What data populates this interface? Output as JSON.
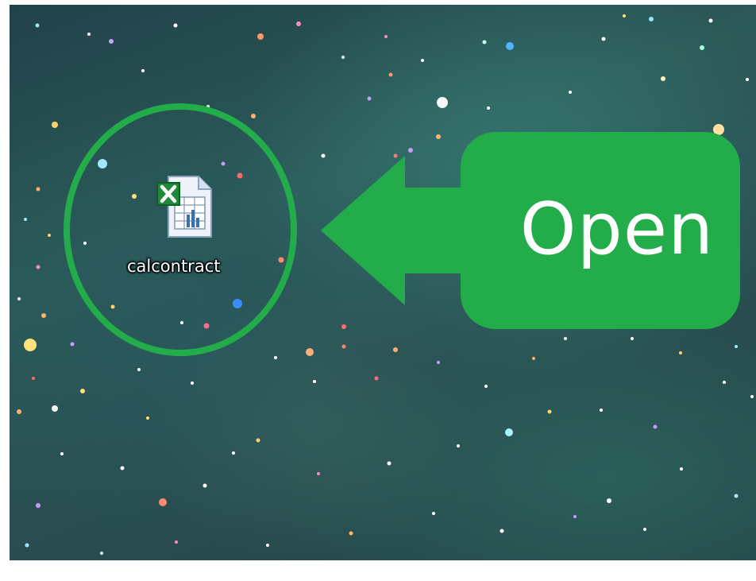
{
  "desktop": {
    "icon": {
      "icon_name": "excel-spreadsheet-icon",
      "label": "calcontract"
    }
  },
  "annotation": {
    "callout_text": "Open",
    "accent_color": "#22ad4a"
  }
}
